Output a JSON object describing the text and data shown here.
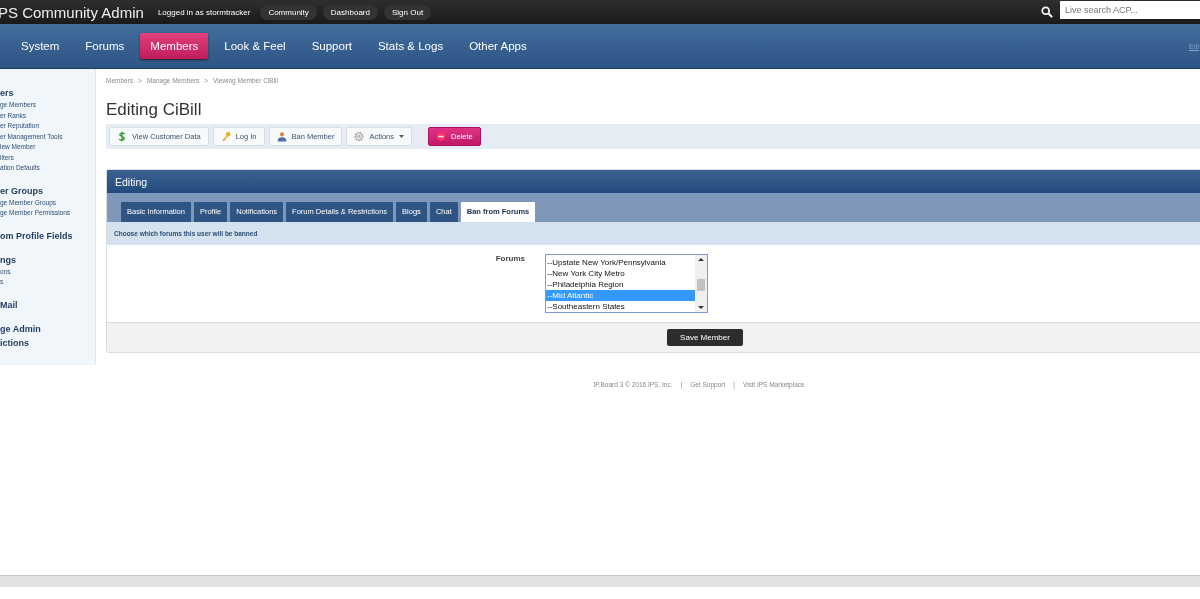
{
  "top_bar": {
    "title": "PS Community Admin",
    "logged_in": "Logged in as stormtracker",
    "links": [
      "Community",
      "Dashboard",
      "Sign Out"
    ],
    "search": {
      "placeholder": "Live search ACP..."
    }
  },
  "nav": {
    "items": [
      {
        "label": "System",
        "selected": false
      },
      {
        "label": "Forums",
        "selected": false
      },
      {
        "label": "Members",
        "selected": true
      },
      {
        "label": "Look & Feel",
        "selected": false
      },
      {
        "label": "Support",
        "selected": false
      },
      {
        "label": "Stats & Logs",
        "selected": false
      },
      {
        "label": "Other Apps",
        "selected": false
      }
    ],
    "edge_link": "Edi"
  },
  "sidebar": {
    "groups": [
      {
        "heading": "ers",
        "items": [
          "ge Members",
          "er Ranks",
          "er Reputation",
          "er Management Tools",
          "lew Member",
          "ilters",
          "ation Defaults"
        ]
      },
      {
        "heading": "er Groups",
        "items": [
          "ge Member Groups",
          "ge Member Permissions"
        ]
      },
      {
        "heading": "om Profile Fields"
      },
      {
        "heading": "ngs",
        "items": [
          "ons",
          "s"
        ]
      },
      {
        "heading": "Mail"
      },
      {
        "heading": "ge Admin\nictions"
      }
    ]
  },
  "breadcrumb": [
    "Members",
    "Manage Members",
    "Viewing Member CiBill"
  ],
  "breadcrumb_separator": ">",
  "page_title": "Editing CiBill",
  "toolbar": [
    {
      "label": "View Customer Data",
      "kind": "dollar"
    },
    {
      "label": "Log In",
      "kind": "key"
    },
    {
      "label": "Ban Member",
      "kind": "user"
    },
    {
      "label": "Actions",
      "kind": "menu"
    },
    {
      "label": "Delete",
      "kind": "danger"
    }
  ],
  "panel": {
    "title": "Editing",
    "tabs": [
      {
        "label": "Basic Information",
        "selected": false
      },
      {
        "label": "Profile",
        "selected": false
      },
      {
        "label": "Notifications",
        "selected": false
      },
      {
        "label": "Forum Details & Restrictions",
        "selected": false
      },
      {
        "label": "Blogs",
        "selected": false
      },
      {
        "label": "Chat",
        "selected": false
      },
      {
        "label": "Ban from Forums",
        "selected": true
      }
    ],
    "description": "Choose which forums this user will be banned",
    "field": {
      "label": "Forums",
      "options": [
        {
          "label": "--Upstate New York/Pennsylvania",
          "selected": false
        },
        {
          "label": "--New York City Metro",
          "selected": false
        },
        {
          "label": "--Philadelphia Region",
          "selected": false
        },
        {
          "label": "--Mid Atlantic",
          "selected": true
        },
        {
          "label": "--Southeastern States",
          "selected": false
        }
      ]
    },
    "save_button": "Save Member"
  },
  "footer": {
    "items": [
      "IP.Board 3 © 2016 IPS, Inc.",
      "Get Support",
      "Visit IPS Marketplace"
    ],
    "separator": "|"
  }
}
